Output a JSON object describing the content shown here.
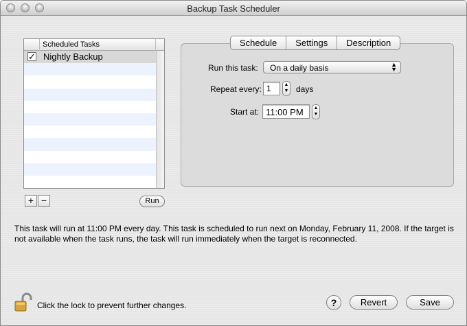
{
  "window": {
    "title": "Backup Task Scheduler"
  },
  "task_list": {
    "header": "Scheduled Tasks",
    "tasks": [
      {
        "name": "Nightly Backup",
        "checked": true,
        "selected": true
      }
    ],
    "add_label": "+",
    "remove_label": "−",
    "run_label": "Run"
  },
  "tabs": [
    {
      "label": "Schedule",
      "selected": true
    },
    {
      "label": "Settings",
      "selected": false
    },
    {
      "label": "Description",
      "selected": false
    }
  ],
  "schedule": {
    "run_label": "Run this task:",
    "run_value": "On a daily basis",
    "repeat_label": "Repeat every:",
    "repeat_value": "1",
    "repeat_unit": "days",
    "start_label": "Start at:",
    "start_value": "11:00 PM"
  },
  "info_text": "This task will run at 11:00 PM every day. This task is scheduled to run next on Monday, February 11, 2008. If the target is not available when the task runs, the task will run immediately when the target is reconnected.",
  "footer": {
    "lock_text": "Click the lock to prevent further changes.",
    "help_label": "?",
    "revert_label": "Revert",
    "save_label": "Save"
  }
}
